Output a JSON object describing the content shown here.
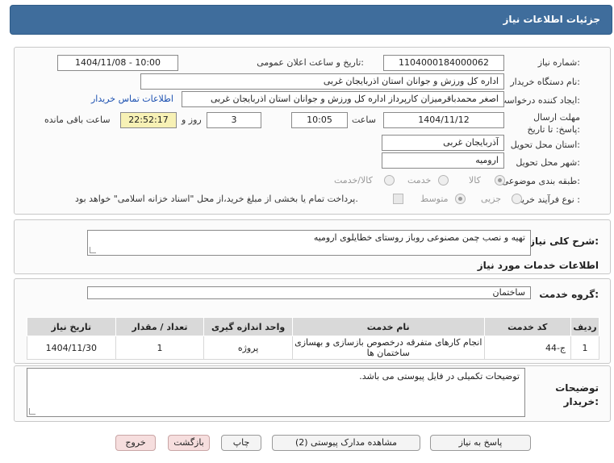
{
  "header": {
    "title": "جزئیات اطلاعات نیاز"
  },
  "form": {
    "need_number_label": "شماره نیاز:",
    "need_number": "1104000184000062",
    "announce_label": "تاریخ و ساعت اعلان عمومی:",
    "announce_value": "1404/11/08 - 10:00",
    "buyer_org_label": "نام دستگاه خریدار:",
    "buyer_org": "اداره کل ورزش و جوانان استان اذربایجان غربی",
    "creator_label": "ایجاد کننده درخواست:",
    "creator": "اصغر محمدباقرمیزان کارپرداز اداره کل ورزش و جوانان استان اذربایجان غربی",
    "contact_link": "اطلاعات تماس خریدار",
    "deadline_label": "مهلت ارسال پاسخ: تا تاریخ:",
    "deadline_date": "1404/11/12",
    "time_label": "ساعت",
    "deadline_time": "10:05",
    "days_value": "3",
    "days_label": "روز و",
    "remaining_time": "22:52:17",
    "remaining_label": "ساعت باقی مانده",
    "province_label": "استان محل تحویل:",
    "province": "آذربایجان غربی",
    "city_label": "شهر محل تحویل:",
    "city": "ارومیه",
    "category_label": "طبقه بندی موضوعی:",
    "category_options": [
      "کالا",
      "خدمت",
      "کالا/خدمت"
    ],
    "process_label": "نوع فرآیند خرید :",
    "process_options": [
      "جزیی",
      "متوسط"
    ],
    "payment_note": "پرداخت تمام یا بخشی از مبلغ خرید،از محل \"اسناد خزانه اسلامی\" خواهد بود."
  },
  "description": {
    "label": "شرح کلی نیاز:",
    "value": "تهیه و نصب چمن مصنوعی روباز روستای خطایلوی ارومیه"
  },
  "services": {
    "section_title": "اطلاعات خدمات مورد نیاز",
    "group_label": "گروه خدمت:",
    "group_value": "ساختمان",
    "columns": [
      "ردیف",
      "کد خدمت",
      "نام خدمت",
      "واحد اندازه گیری",
      "تعداد / مقدار",
      "تاریخ نیاز"
    ],
    "rows": [
      {
        "row": "1",
        "code": "ج-44",
        "name": "انجام کارهای متفرقه درخصوص بازسازی و بهسازی ساختمان ها",
        "unit": "پروژه",
        "qty": "1",
        "date": "1404/11/30"
      }
    ]
  },
  "buyer_notes": {
    "label": "توضیحات خریدار:",
    "value": "توضیحات تکمیلی در فایل پیوستی می باشد."
  },
  "buttons": {
    "reply": "پاسخ به نیاز",
    "attachments": "مشاهده مدارک پیوستی (2)",
    "print": "چاپ",
    "back": "بازگشت",
    "exit": "خروج"
  },
  "colors": {
    "header": "#3f6d9c",
    "remaining_bg": "#f7f1b5",
    "exit_bg": "#f6dede"
  }
}
